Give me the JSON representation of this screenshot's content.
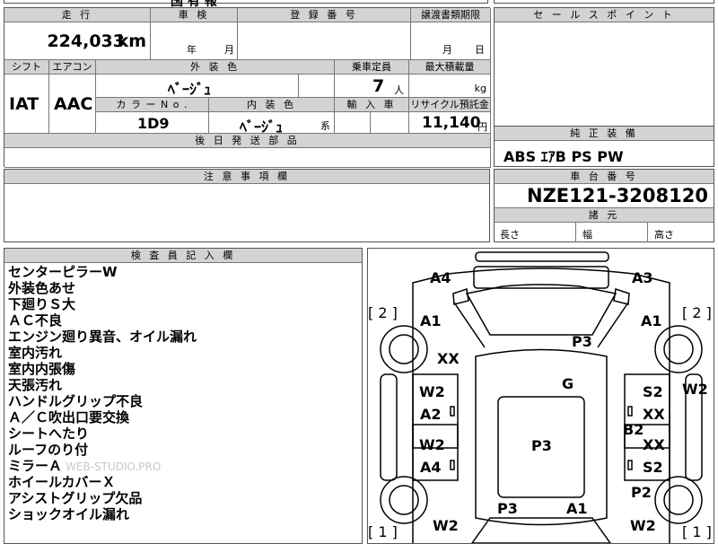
{
  "top_cut": {
    "text": "国 有 報"
  },
  "table": {
    "mileage": {
      "header": "走 行",
      "value": "224,033",
      "unit": "km"
    },
    "inspection": {
      "header": "車 検",
      "year": "年",
      "month": "月"
    },
    "registration": {
      "header": "登 録 番 号",
      "value": ""
    },
    "transfer_deadline": {
      "header": "譲渡書類期限",
      "month": "月",
      "day": "日"
    },
    "shift": {
      "header": "シフト",
      "value": "IAT"
    },
    "aircon": {
      "header": "エアコン",
      "value": "AAC"
    },
    "exterior_color": {
      "header": "外 装 色",
      "value": "ﾍﾞｰｼﾞｭ"
    },
    "capacity": {
      "header": "乗車定員",
      "value": "7",
      "unit": "人"
    },
    "max_load": {
      "header": "最大積載量",
      "unit": "kg"
    },
    "color_no": {
      "header": "カ ラ ー N o .",
      "value": "1D9"
    },
    "interior_color": {
      "header": "内 装 色",
      "value": "ﾍﾞｰｼﾞｭ",
      "suffix": "系"
    },
    "import": {
      "header": "輸 入 車"
    },
    "recycle": {
      "header": "リサイクル預託金",
      "value": "11,140",
      "unit": "円"
    },
    "later_parts": {
      "header": "後 日 発 送 部 品"
    }
  },
  "sales_point": {
    "header": "セ ー ル ス ポ イ ン ト"
  },
  "equipment": {
    "header": "純 正 装 備",
    "value": "ABS ｴｱB PS PW"
  },
  "caution": {
    "header": "注 意 事 項 欄"
  },
  "chassis": {
    "header": "車 台 番 号",
    "value": "NZE121-3208120"
  },
  "dimensions": {
    "header": "諸 元",
    "length": "長さ",
    "width": "幅",
    "height": "高さ"
  },
  "inspector": {
    "header": "検 査 員 記 入 欄",
    "notes": [
      "センターピラーW",
      "外装色あせ",
      "下廻りＳ大",
      "ＡＣ不良",
      "エンジン廻り異音、オイル漏れ",
      "室内汚れ",
      "室内内張傷",
      "天張汚れ",
      "ハンドルグリップ不良",
      "Ａ／Ｃ吹出口要交換",
      "シートへたり",
      "ルーフのり付",
      "ミラーＡ",
      "ホイールカバーＸ",
      "アシストグリップ欠品",
      "ショックオイル漏れ"
    ],
    "watermark": "WEB-STUDIO.PRO"
  },
  "diagram": {
    "labels": {
      "a4_top": "A4",
      "a3_top": "A3",
      "br_l": "[ 2 ]",
      "br_r": "[ 2 ]",
      "a1_l": "A1",
      "a1_r": "A1",
      "xx_l": "XX",
      "p3_hood": "P3",
      "g": "G",
      "w2_l1": "W2",
      "a2_l": "A2",
      "s2_r1": "S2",
      "xx_r1": "XX",
      "w2_side": "W2",
      "b2": "B2",
      "w2_l2": "W2",
      "a4_l": "A4",
      "xx_r2": "XX",
      "s2_r2": "S2",
      "p3_roof": "P3",
      "p3_rear": "P3",
      "a1_rear": "A1",
      "p2": "P2",
      "br_bl": "[ 1 ]",
      "br_br": "[ 1 ]",
      "w2_bl": "W2",
      "w2_br": "W2"
    }
  }
}
